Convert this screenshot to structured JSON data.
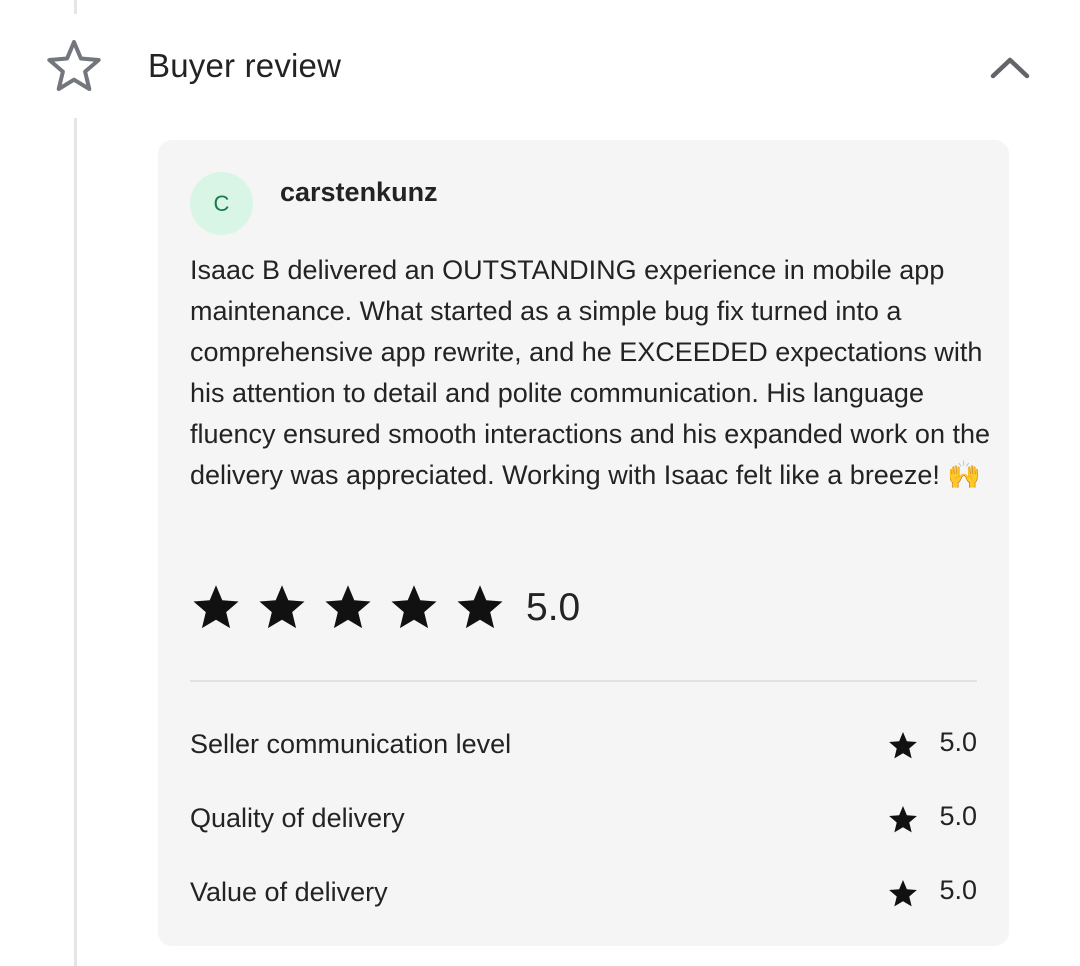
{
  "section": {
    "title": "Buyer review",
    "icon": "star-outline-icon",
    "toggle_icon": "chevron-up-icon"
  },
  "review": {
    "avatar_initial": "C",
    "username": "carstenkunz",
    "text": "Isaac B delivered an OUTSTANDING experience in mobile app maintenance. What started as a simple bug fix turned into a comprehensive app rewrite, and he EXCEEDED expectations with his attention to detail and polite communication. His language fluency ensured smooth interactions and his expanded work on the delivery was appreciated. Working with Isaac felt like a breeze! 🙌",
    "stars": 5,
    "rating": "5.0",
    "criteria": [
      {
        "label": "Seller communication level",
        "value": "5.0"
      },
      {
        "label": "Quality of delivery",
        "value": "5.0"
      },
      {
        "label": "Value of delivery",
        "value": "5.0"
      }
    ]
  },
  "colors": {
    "text": "#222325",
    "card_background": "#f5f5f5",
    "avatar_background": "#d9f5e5",
    "avatar_text": "#1b7a4a",
    "star": "#111111",
    "timeline": "#e4e5e7"
  }
}
